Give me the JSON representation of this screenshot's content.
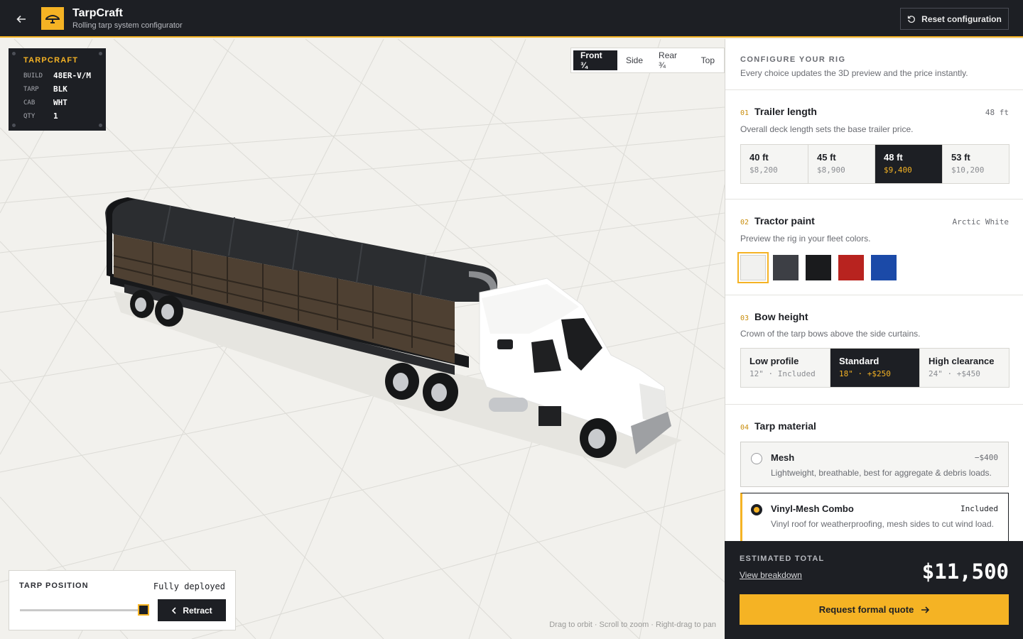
{
  "header": {
    "back_icon": "arrow-left-icon",
    "logo_icon": "tarp-bow-icon",
    "title": "TarpCraft",
    "subtitle": "Rolling tarp system configurator",
    "reset_label": "Reset configuration",
    "reset_icon": "rotate-ccw-icon"
  },
  "build_card": {
    "brand": "TARPCRAFT",
    "rows": [
      {
        "key": "BUILD",
        "value": "48ER-V/M"
      },
      {
        "key": "TARP",
        "value": "BLK"
      },
      {
        "key": "CAB",
        "value": "WHT"
      },
      {
        "key": "QTY",
        "value": "1"
      }
    ]
  },
  "view_tabs": {
    "items": [
      "Front ¾",
      "Side",
      "Rear ¾",
      "Top"
    ],
    "active": "Front ¾"
  },
  "tarp_position": {
    "label": "TARP POSITION",
    "status": "Fully deployed",
    "value_pct": 100,
    "button_label": "Retract",
    "button_icon": "chevron-left-icon"
  },
  "hint": "Drag to orbit · Scroll to zoom · Right-drag to pan",
  "panel": {
    "kicker": "CONFIGURE YOUR RIG",
    "subtitle": "Every choice updates the 3D preview and the price instantly.",
    "trailer_length": {
      "num": "01",
      "title": "Trailer length",
      "value": "48 ft",
      "desc": "Overall deck length sets the base trailer price.",
      "options": [
        {
          "label": "40 ft",
          "price": "$8,200"
        },
        {
          "label": "45 ft",
          "price": "$8,900"
        },
        {
          "label": "48 ft",
          "price": "$9,400"
        },
        {
          "label": "53 ft",
          "price": "$10,200"
        }
      ],
      "selected": 2
    },
    "tractor_paint": {
      "num": "02",
      "title": "Tractor paint",
      "value": "Arctic White",
      "desc": "Preview the rig in your fleet colors.",
      "swatches": [
        "#f1f1ef",
        "#3d3f45",
        "#1a1b1d",
        "#b8231f",
        "#1b4aa8"
      ],
      "selected": 0
    },
    "bow_height": {
      "num": "03",
      "title": "Bow height",
      "desc": "Crown of the tarp bows above the side curtains.",
      "options": [
        {
          "label": "Low profile",
          "detail": "12\" · Included"
        },
        {
          "label": "Standard",
          "detail": "18\" · +$250"
        },
        {
          "label": "High clearance",
          "detail": "24\" · +$450"
        }
      ],
      "selected": 1
    },
    "tarp_material": {
      "num": "04",
      "title": "Tarp material",
      "options": [
        {
          "name": "Mesh",
          "price": "−$400",
          "desc": "Lightweight, breathable, best for aggregate & debris loads."
        },
        {
          "name": "Vinyl-Mesh Combo",
          "price": "Included",
          "desc": "Vinyl roof for weatherproofing, mesh sides to cut wind load."
        }
      ],
      "selected": 1
    }
  },
  "total": {
    "kicker": "ESTIMATED TOTAL",
    "link": "View breakdown",
    "value": "$11,500",
    "button_label": "Request formal quote",
    "button_icon": "arrow-right-icon"
  },
  "colors": {
    "accent": "#f5b324",
    "dark": "#1d1f24"
  }
}
